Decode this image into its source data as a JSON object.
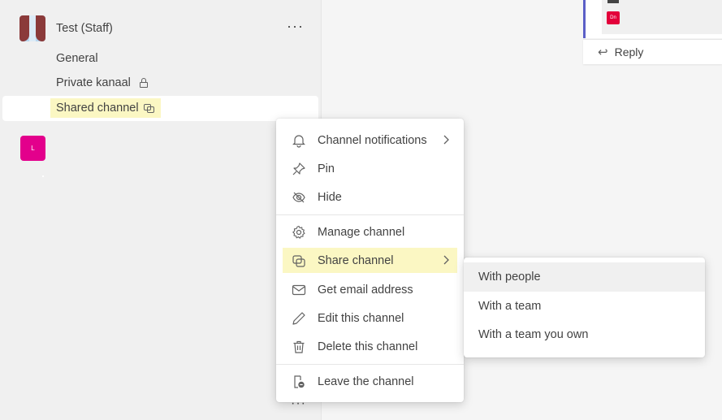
{
  "team": {
    "name": "Test (Staff)",
    "more": "···"
  },
  "channels": {
    "general": "General",
    "private": "Private kanaal",
    "shared": "Shared channel"
  },
  "second_team_avatar": "L",
  "message": {
    "badge": "Dn",
    "reply_label": "Reply"
  },
  "menu": {
    "items": [
      {
        "label": "Channel notifications",
        "icon": "bell-icon",
        "has_submenu": true
      },
      {
        "label": "Pin",
        "icon": "pin-icon"
      },
      {
        "label": "Hide",
        "icon": "eye-off-icon"
      },
      {
        "label": "Manage channel",
        "icon": "gear-icon"
      },
      {
        "label": "Share channel",
        "icon": "share-channel-icon",
        "has_submenu": true,
        "highlighted": true
      },
      {
        "label": "Get email address",
        "icon": "mail-icon"
      },
      {
        "label": "Edit this channel",
        "icon": "pencil-icon"
      },
      {
        "label": "Delete this channel",
        "icon": "trash-icon"
      },
      {
        "label": "Leave the channel",
        "icon": "leave-icon"
      }
    ]
  },
  "submenu": {
    "items": [
      {
        "label": "With people",
        "hovered": true
      },
      {
        "label": "With a team"
      },
      {
        "label": "With a team you own"
      }
    ]
  },
  "bottom_more": "···",
  "colors": {
    "highlight": "#fbf7c3",
    "accent": "#5b5fc7",
    "avatar_pink": "#e3008c"
  }
}
